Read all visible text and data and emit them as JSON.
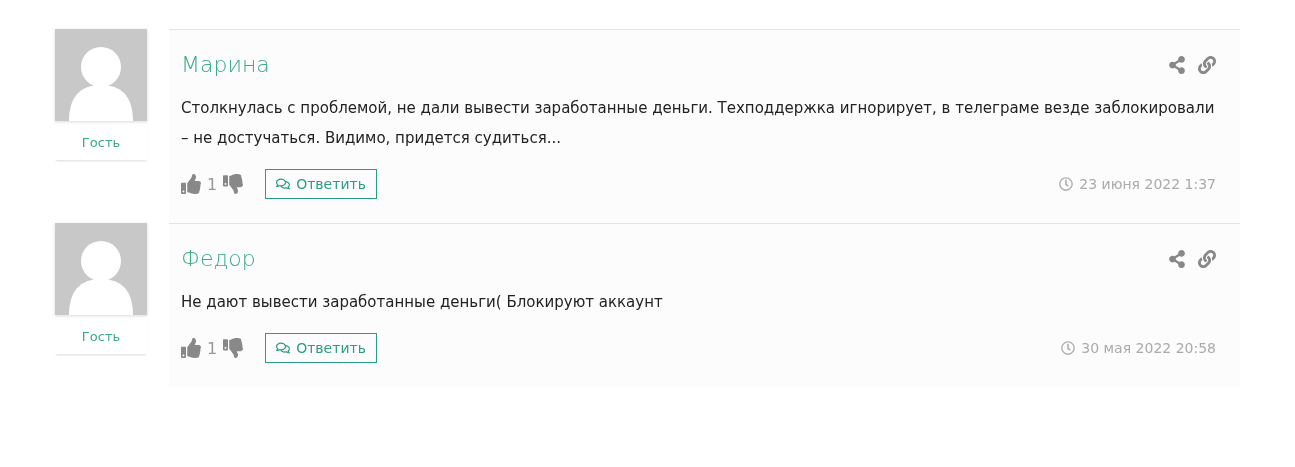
{
  "comments": [
    {
      "author_role": "Гость",
      "name": "Марина",
      "text": "Столкнулась с проблемой, не дали вывести заработанные деньги. Техподдержка игнорирует, в телеграме везде заблокировали – не достучаться. Видимо, придется судиться...",
      "likes": "1",
      "reply": "Ответить",
      "date": "23 июня 2022 1:37"
    },
    {
      "author_role": "Гость",
      "name": "Федор",
      "text": "Не дают вывести заработанные деньги( Блокируют аккаунт",
      "likes": "1",
      "reply": "Ответить",
      "date": "30 мая 2022 20:58"
    }
  ]
}
